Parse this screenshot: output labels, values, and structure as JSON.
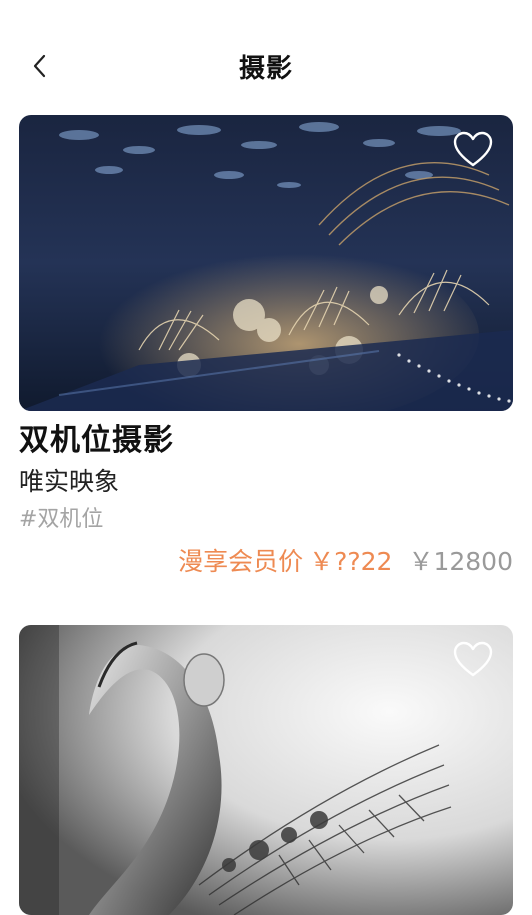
{
  "header": {
    "title": "摄影"
  },
  "cards": [
    {
      "title": "双机位摄影",
      "studio": "唯实映象",
      "tag": "#双机位",
      "member_label": "漫享会员价",
      "member_price": "￥??22",
      "original_price": "￥12800"
    },
    {
      "title": "",
      "studio": "",
      "tag": "",
      "member_label": "",
      "member_price": "",
      "original_price": ""
    }
  ],
  "icons": {
    "back": "chevron-left-icon",
    "favorite": "heart-outline-icon"
  },
  "colors": {
    "member_price": "#ee8a52",
    "original_price": "#9a9a9a",
    "tag": "#a4a4a4"
  }
}
